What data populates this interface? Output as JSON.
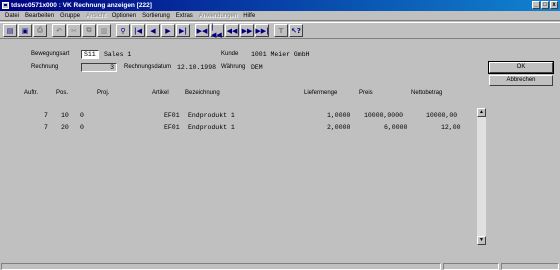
{
  "window": {
    "title": "tdsvc0571x000 : VK Rechnung anzeigen [222]",
    "controls": [
      "_",
      "□",
      "x"
    ]
  },
  "menu": [
    {
      "label": "Datei",
      "disabled": false
    },
    {
      "label": "Bearbeiten",
      "disabled": false
    },
    {
      "label": "Gruppe",
      "disabled": false
    },
    {
      "label": "Ansicht",
      "disabled": true
    },
    {
      "label": "Optionen",
      "disabled": false
    },
    {
      "label": "Sortierung",
      "disabled": false
    },
    {
      "label": "Extras",
      "disabled": false
    },
    {
      "label": "Anwendungen",
      "disabled": true
    },
    {
      "label": "Hilfe",
      "disabled": false
    }
  ],
  "toolbar": [
    {
      "icon": "open-icon",
      "glyph": "▤"
    },
    {
      "icon": "save-icon",
      "glyph": "▣"
    },
    {
      "icon": "print-icon",
      "glyph": "⎙"
    },
    {
      "icon": "undo-icon",
      "glyph": "↶"
    },
    {
      "icon": "cut-icon",
      "glyph": "✂"
    },
    {
      "icon": "copy-icon",
      "glyph": "⧉"
    },
    {
      "icon": "paste-icon",
      "glyph": "▥"
    },
    {
      "icon": "find-icon",
      "glyph": "⚲"
    },
    {
      "icon": "first-record-icon",
      "glyph": "|◀"
    },
    {
      "icon": "previous-record-icon",
      "glyph": "◀"
    },
    {
      "icon": "next-record-icon",
      "glyph": "▶"
    },
    {
      "icon": "last-record-icon",
      "glyph": "▶|"
    },
    {
      "icon": "first-page-icon",
      "glyph": "▶◀"
    },
    {
      "icon": "first-set-icon",
      "glyph": "|◀◀"
    },
    {
      "icon": "previous-page-icon",
      "glyph": "◀◀"
    },
    {
      "icon": "next-page-icon",
      "glyph": "▶▶"
    },
    {
      "icon": "last-page-icon",
      "glyph": "▶▶|"
    },
    {
      "icon": "text-icon",
      "glyph": "T"
    },
    {
      "icon": "context-help-icon",
      "glyph": "↖?"
    }
  ],
  "header": {
    "bewegungsart_label": "Bewegungsart",
    "bewegungsart_value": "S11",
    "bewegungsart_desc": "Sales 1",
    "kunde_label": "Kunde",
    "kunde_value": "1001 Meier GmbH",
    "rechnung_label": "Rechnung",
    "rechnung_value": "3",
    "rechnungsdatum_label": "Rechnungsdatum",
    "rechnungsdatum_value": "12.10.1998",
    "waehrung_label": "Währung",
    "waehrung_value": "DEM"
  },
  "buttons": {
    "ok": "OK",
    "abbrechen": "Abbrechen"
  },
  "table": {
    "columns": [
      "Auftr.",
      "Pos.",
      "Proj.",
      "Artikel",
      "Bezeichnung",
      "Liefermenge",
      "Preis",
      "Nettobetrag"
    ],
    "rows": [
      {
        "auftr": "7",
        "pos": "10",
        "seq": "0",
        "artikel": "EF01",
        "bezeichnung": "Endprodukt 1",
        "liefermenge": "1,0000",
        "preis": "10000,0000",
        "nettobetrag": "10000,00"
      },
      {
        "auftr": "7",
        "pos": "20",
        "seq": "0",
        "artikel": "EF01",
        "bezeichnung": "Endprodukt 1",
        "liefermenge": "2,0000",
        "preis": "6,0000",
        "nettobetrag": "12,00"
      }
    ]
  }
}
